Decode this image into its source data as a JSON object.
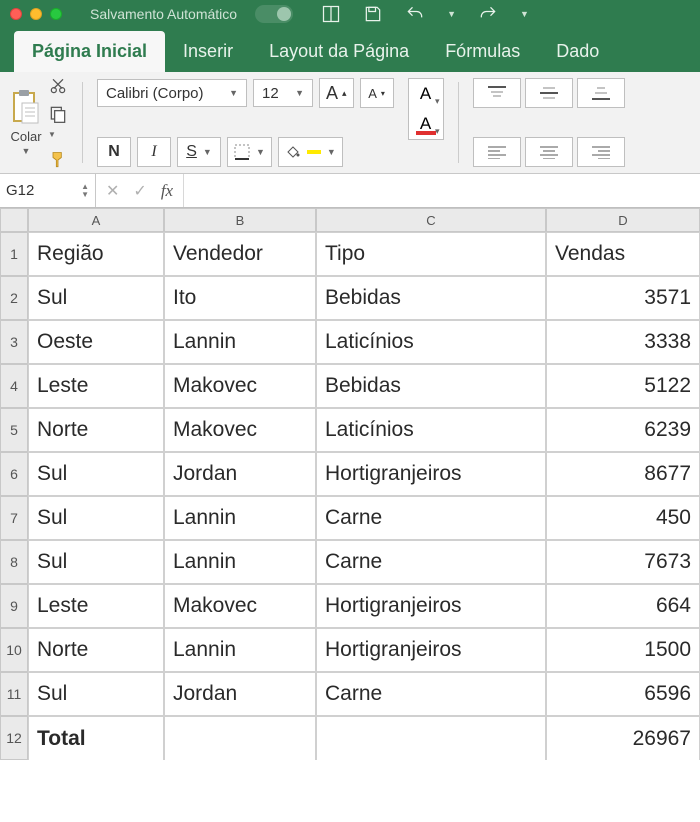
{
  "titlebar": {
    "autosave_label": "Salvamento Automático"
  },
  "tabs": {
    "home": "Página Inicial",
    "insert": "Inserir",
    "layout": "Layout da Página",
    "formulas": "Fórmulas",
    "data": "Dado"
  },
  "ribbon": {
    "paste_label": "Colar",
    "font_name": "Calibri (Corpo)",
    "font_size": "12",
    "bold": "N",
    "italic": "I",
    "underline": "S",
    "grow": "A",
    "shrink": "A",
    "font_color": "A"
  },
  "formula_bar": {
    "name_box": "G12",
    "cancel": "✕",
    "confirm": "✓",
    "fx": "fx",
    "value": ""
  },
  "columns": [
    "A",
    "B",
    "C",
    "D"
  ],
  "row_numbers": [
    "1",
    "2",
    "3",
    "4",
    "5",
    "6",
    "7",
    "8",
    "9",
    "10",
    "11",
    "12"
  ],
  "headers": {
    "A": "Região",
    "B": "Vendedor",
    "C": "Tipo",
    "D": "Vendas"
  },
  "rows": [
    {
      "A": "Sul",
      "B": "Ito",
      "C": "Bebidas",
      "D": "3571"
    },
    {
      "A": "Oeste",
      "B": "Lannin",
      "C": "Laticínios",
      "D": "3338"
    },
    {
      "A": "Leste",
      "B": "Makovec",
      "C": "Bebidas",
      "D": "5122"
    },
    {
      "A": "Norte",
      "B": "Makovec",
      "C": "Laticínios",
      "D": "6239"
    },
    {
      "A": "Sul",
      "B": "Jordan",
      "C": "Hortigranjeiros",
      "D": "8677"
    },
    {
      "A": "Sul",
      "B": "Lannin",
      "C": "Carne",
      "D": "450"
    },
    {
      "A": "Sul",
      "B": "Lannin",
      "C": "Carne",
      "D": "7673"
    },
    {
      "A": "Leste",
      "B": "Makovec",
      "C": "Hortigranjeiros",
      "D": "664"
    },
    {
      "A": "Norte",
      "B": "Lannin",
      "C": "Hortigranjeiros",
      "D": "1500"
    },
    {
      "A": "Sul",
      "B": "Jordan",
      "C": "Carne",
      "D": "6596"
    }
  ],
  "total_row": {
    "A": "Total",
    "B": "",
    "C": "",
    "D": "26967"
  }
}
